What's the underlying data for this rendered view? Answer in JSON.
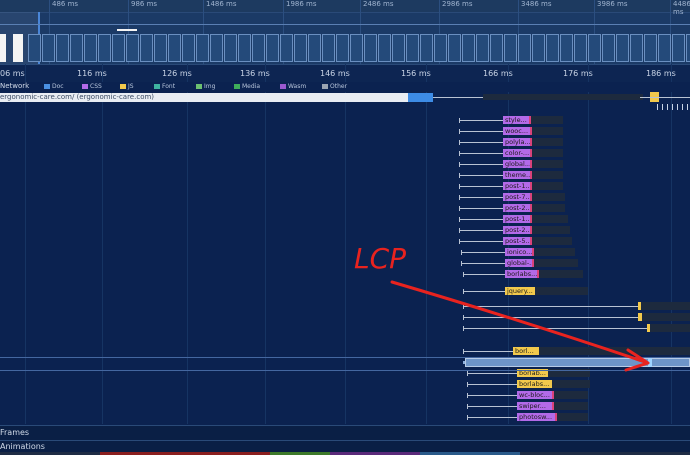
{
  "overview": {
    "tick_labels": [
      "486 ms",
      "986 ms",
      "1486 ms",
      "1986 ms",
      "2486 ms",
      "2986 ms",
      "3486 ms",
      "3986 ms",
      "4486 ms"
    ]
  },
  "ruler": {
    "labels": [
      "06 ms",
      "116 ms",
      "126 ms",
      "136 ms",
      "146 ms",
      "156 ms",
      "166 ms",
      "176 ms",
      "186 ms"
    ]
  },
  "network": {
    "title": "Network",
    "legend": [
      {
        "label": "Doc",
        "color": "#4a90e2"
      },
      {
        "label": "CSS",
        "color": "#b36ae8"
      },
      {
        "label": "JS",
        "color": "#f2c94c"
      },
      {
        "label": "Font",
        "color": "#3fb3a0"
      },
      {
        "label": "Img",
        "color": "#6cc070"
      },
      {
        "label": "Media",
        "color": "#3fae5a"
      },
      {
        "label": "Wasm",
        "color": "#9b59d0"
      },
      {
        "label": "Other",
        "color": "#9aa4b2"
      }
    ],
    "document_label": "ergonomic-care.com/ (ergonomic-care.com)"
  },
  "requests": [
    {
      "label": "style...",
      "type": "css"
    },
    {
      "label": "wooc...",
      "type": "css"
    },
    {
      "label": "polyla...",
      "type": "css"
    },
    {
      "label": "color-...",
      "type": "css"
    },
    {
      "label": "global...",
      "type": "css"
    },
    {
      "label": "theme...",
      "type": "css"
    },
    {
      "label": "post-1...",
      "type": "css"
    },
    {
      "label": "post-7...",
      "type": "css"
    },
    {
      "label": "post-2...",
      "type": "css"
    },
    {
      "label": "post-1...",
      "type": "css"
    },
    {
      "label": "post-2...",
      "type": "css"
    },
    {
      "label": "post-5...",
      "type": "css"
    },
    {
      "label": "ionico...",
      "type": "css"
    },
    {
      "label": "global-...",
      "type": "css"
    },
    {
      "label": "borlabs...",
      "type": "css"
    },
    {
      "label": "jquery...",
      "type": "js"
    },
    {
      "label": "",
      "type": "js"
    },
    {
      "label": "",
      "type": "js"
    },
    {
      "label": "",
      "type": "js"
    },
    {
      "label": "borl...",
      "type": "js"
    },
    {
      "label": "",
      "type": "selected"
    },
    {
      "label": "borlab...",
      "type": "js"
    },
    {
      "label": "borlabs...",
      "type": "js"
    },
    {
      "label": "wc-bloc...",
      "type": "css"
    },
    {
      "label": "swiper...",
      "type": "css"
    },
    {
      "label": "photosw...",
      "type": "css"
    }
  ],
  "tracks": {
    "frames": "Frames",
    "animations": "Animations"
  },
  "annotation": {
    "text": "LCP",
    "color": "#e8231f"
  }
}
